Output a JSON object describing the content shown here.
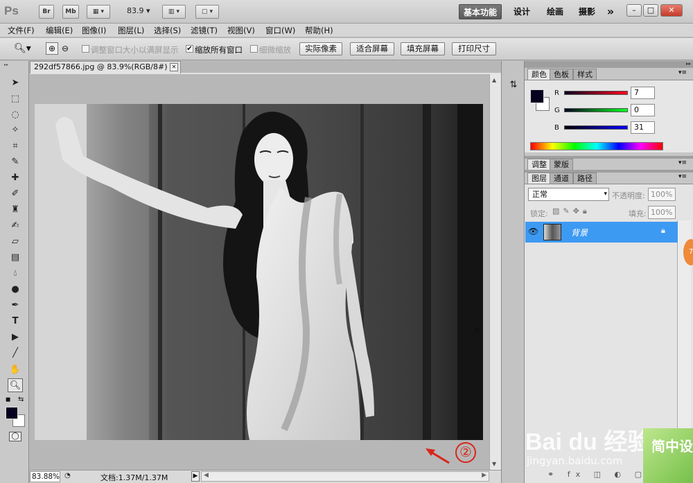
{
  "app": {
    "logo": "Ps",
    "bridge_button": "Br",
    "minibridge_button": "Mb",
    "zoom": "83.9",
    "workspaces": [
      "基本功能",
      "设计",
      "绘画",
      "摄影"
    ],
    "more": "»"
  },
  "menu": [
    "文件(F)",
    "编辑(E)",
    "图像(I)",
    "图层(L)",
    "选择(S)",
    "滤镜(T)",
    "视图(V)",
    "窗口(W)",
    "帮助(H)"
  ],
  "options": {
    "resize_windows": "调整窗口大小以满屏显示",
    "zoom_all": "缩放所有窗口",
    "scrubby": "细微缩放",
    "buttons": [
      "实际像素",
      "适合屏幕",
      "填充屏幕",
      "打印尺寸"
    ]
  },
  "document": {
    "tab_title": "292df57866.jpg @ 83.9%(RGB/8#) *",
    "status_zoom": "83.88%",
    "status_doc": "文档:1.37M/1.37M"
  },
  "annotation": "②",
  "color_panel": {
    "tabs": [
      "颜色",
      "色板",
      "样式"
    ],
    "channels": [
      {
        "name": "R",
        "value": "7",
        "color": "#c8102e"
      },
      {
        "name": "G",
        "value": "0",
        "color": "#1faa2e"
      },
      {
        "name": "B",
        "value": "31",
        "color": "#1a2fd0"
      }
    ],
    "foreground": "#07001f"
  },
  "adjust_panel": {
    "tabs": [
      "调整",
      "蒙版"
    ]
  },
  "layers_panel": {
    "tabs": [
      "图层",
      "通道",
      "路径"
    ],
    "blend_mode": "正常",
    "opacity_label": "不透明度:",
    "opacity_value": "100%",
    "lock_label": "锁定:",
    "fill_label": "填充:",
    "fill_value": "100%",
    "layer_name": "背景"
  },
  "badge": "7",
  "watermark": {
    "brand": "Bai du 经验",
    "url": "jingyan.baidu.com",
    "corner": "简中设"
  }
}
